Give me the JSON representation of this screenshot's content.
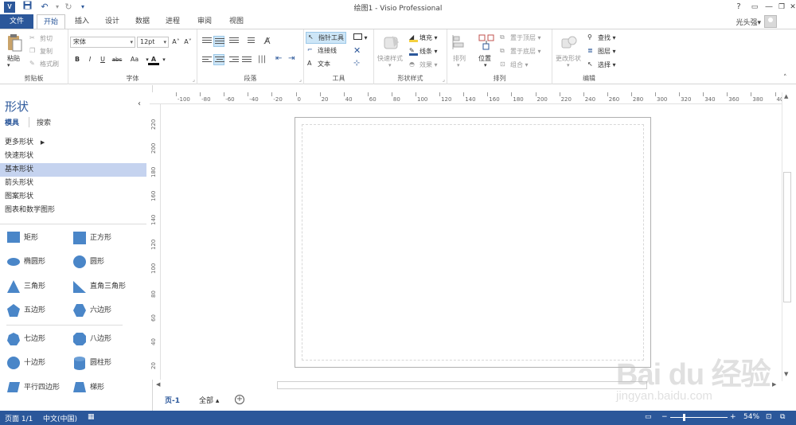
{
  "window": {
    "title": "绘图1 - Visio Professional",
    "app_icon": "V",
    "help": "?",
    "minimize": "—",
    "restore": "❐",
    "close": "✕"
  },
  "quick_access": {
    "save": "💾",
    "undo": "↶",
    "redo": "↻",
    "customize": "▾"
  },
  "tabs": [
    "文件",
    "开始",
    "插入",
    "设计",
    "数据",
    "进程",
    "审阅",
    "视图"
  ],
  "active_tab": "开始",
  "user": {
    "name": "光头强",
    "dropdown": "▾"
  },
  "ribbon": {
    "clipboard": {
      "paste": "粘贴",
      "cut": "剪切",
      "copy": "复制",
      "format_painter": "格式刷",
      "label": "剪贴板"
    },
    "font": {
      "name": "宋体",
      "size": "12pt",
      "grow": "A˄",
      "shrink": "A˅",
      "bold": "B",
      "italic": "I",
      "underline": "U",
      "strike": "abc",
      "case": "Aa",
      "color": "A",
      "label": "字体"
    },
    "paragraph": {
      "label": "段落"
    },
    "tools": {
      "pointer": "指针工具",
      "connector": "连接线",
      "text": "文本",
      "label": "工具"
    },
    "shape_styles": {
      "quick": "快速样式",
      "fill": "填充",
      "line": "线条",
      "effects": "效果",
      "label": "形状样式"
    },
    "arrange": {
      "align": "排列",
      "position": "位置",
      "bring_front": "置于顶层",
      "send_back": "置于底层",
      "group": "组合",
      "label": "排列"
    },
    "editing": {
      "change_shape": "更改形状",
      "find": "查找",
      "layers": "图层",
      "select": "选择",
      "label": "编辑"
    }
  },
  "sidebar": {
    "title": "形状",
    "tabs": [
      "模具",
      "搜索"
    ],
    "categories": [
      "更多形状",
      "快速形状",
      "基本形状",
      "箭头形状",
      "图案形状",
      "图表和数学图形"
    ],
    "selected_category": "基本形状",
    "shapes": [
      "矩形",
      "正方形",
      "椭圆形",
      "圆形",
      "三角形",
      "直角三角形",
      "五边形",
      "六边形",
      "七边形",
      "八边形",
      "十边形",
      "圆柱形",
      "平行四边形",
      "梯形"
    ]
  },
  "ruler": {
    "h_ticks": [
      "-100",
      "-80",
      "-60",
      "-40",
      "-20",
      "0",
      "20",
      "40",
      "60",
      "80",
      "100",
      "120",
      "140",
      "160",
      "180",
      "200",
      "220",
      "240",
      "260",
      "280",
      "300",
      "320",
      "340",
      "360",
      "380",
      "40"
    ],
    "v_ticks": [
      "220",
      "200",
      "180",
      "160",
      "140",
      "120",
      "100",
      "80",
      "60",
      "40",
      "20"
    ]
  },
  "page_tabs": {
    "current": "页-1",
    "all": "全部 ▴",
    "add": "+"
  },
  "status": {
    "page": "页面 1/1",
    "language": "中文(中国)",
    "zoom": "54%",
    "zoom_minus": "−",
    "zoom_plus": "+"
  },
  "watermark": {
    "brand": "Bai du 经验",
    "url": "jingyan.baidu.com"
  },
  "colors": {
    "accent": "#2b579a",
    "selected": "#c5d3ef",
    "shape_fill": "#4a86c8"
  }
}
